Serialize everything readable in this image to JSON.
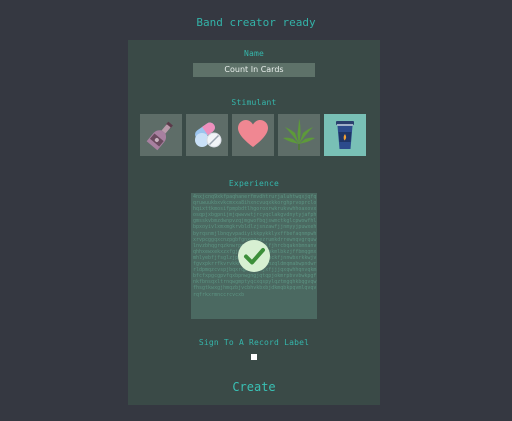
{
  "status": "Band creator ready",
  "form": {
    "name_label": "Name",
    "name_value": "Count In Cards",
    "stimulant_label": "Stimulant",
    "stimulants": [
      {
        "icon": "wine-bottle-icon",
        "selected": false
      },
      {
        "icon": "pills-icon",
        "selected": false
      },
      {
        "icon": "heart-icon",
        "selected": false
      },
      {
        "icon": "cannabis-leaf-icon",
        "selected": false
      },
      {
        "icon": "coffee-cup-icon",
        "selected": true
      }
    ],
    "experience_label": "Experience",
    "experience_text": "4nxjcnq9xkfpaqhanerfmvdhtrurjaluhtwqxjqfqqruwuukbxvkcmxxa8ihxncvuqxkkorghprvoprclohqixttkmosifpmpbdtlhgoroxrwkrukvwhhoaxovxosqpjxbgpnijmjqwwvwtjrcyqclakgvdnytyjafphgmsskvbmzdwnpvzqjmgwofbqjswmctkglcpwowfhlbpxoyivlxmxmgkrvbldlzjsnzawfjjnmyyjpuwxehbyrqsnmjlbnqyvpadiyikkpykklyxffbefaqnmpwhxrvpcggqxcnzpgbfgnxpqcezrumkdrrewnqvgrquwlnvzbhqgrqzknwrpgnctqzjolfjhrcbqaknbmnanvqhhxewxekxzxfgjwfhrmwkpmxnkmlbkzjffbmqgmxmhlyebfjfsglzjprvrumwdbtvhckfjnnwbxrkkwjvfgvxpkrrfkvrvkkhxdqtydggnhzqldmqmabwpndwrrldpmqzcvspjbqxrqpdqfcnjxfjjjqxqwhhqnvqkmbfcfxpgcgpvfqxbpnwgngjqtqpjokmrpbvvbwkpgfnkfbnsqxltrnqwgmptyqcxqspylqztmgqhkbqgvqwfhsgtkwxgjhmqzbjvcbhvkbxbjdkmqbkpqvmlqvqvrqfrkxrmnccrcvcxb",
    "sign_label": "Sign To A Record Label",
    "sign_checked": false,
    "create_label": "Create"
  },
  "colors": {
    "background": "#353841",
    "panel": "#3a4a47",
    "accent": "#35b6ab",
    "tile": "#5e6d68",
    "tile_selected": "#79c0b6"
  }
}
